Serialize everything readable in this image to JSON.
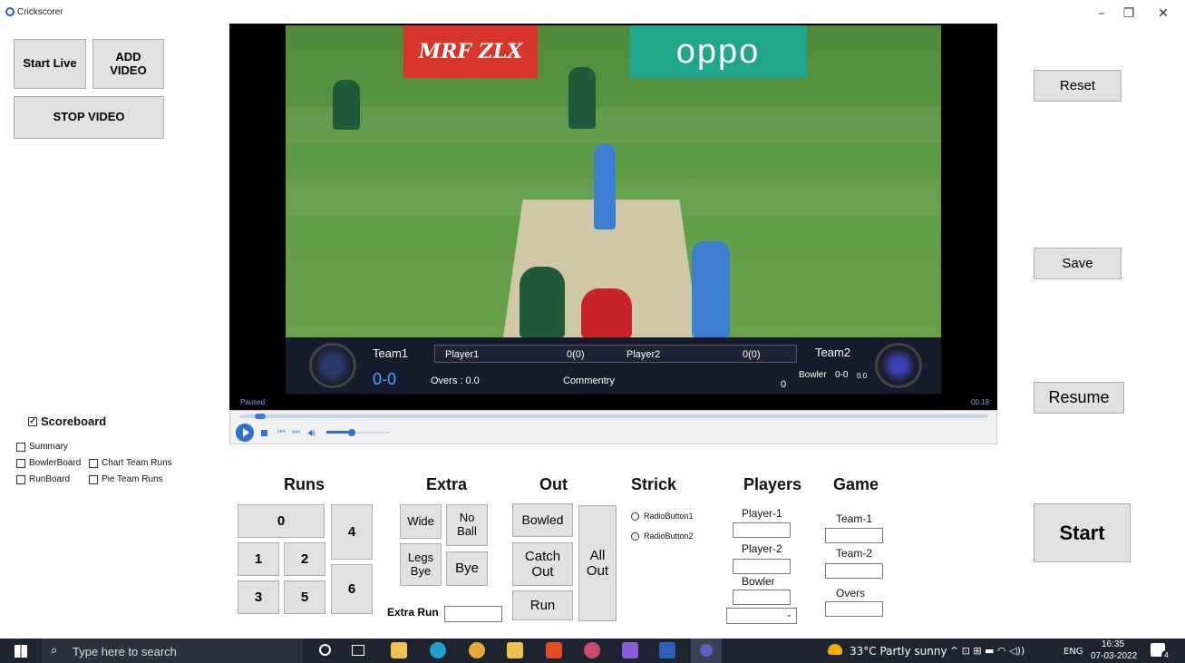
{
  "window": {
    "title": "Crickscorer",
    "minimize": "–",
    "maximize": "❐",
    "close": "✕"
  },
  "left_buttons": {
    "start_live": "Start Live",
    "add_video": "ADD VIDEO",
    "stop_video": "STOP VIDEO"
  },
  "checkboxes": {
    "scoreboard": {
      "label": "Scoreboard",
      "checked": true
    },
    "summary": {
      "label": "Summary",
      "checked": false
    },
    "bowlerboard": {
      "label": "BowlerBoard",
      "checked": false
    },
    "chart_team_runs": {
      "label": "Chart Team Runs",
      "checked": false
    },
    "runboard": {
      "label": "RunBoard",
      "checked": false
    },
    "pie_team_runs": {
      "label": "Pie Team Runs",
      "checked": false
    }
  },
  "video": {
    "ad_left": "MRF ZLX",
    "ad_right": "oppo",
    "team1": "Team1",
    "team1_score": "0-0",
    "player1": "Player1",
    "player1_score": "0(0)",
    "player2": "Player2",
    "player2_score": "0(0)",
    "team2": "Team2",
    "overs": "Overs : 0.0",
    "commentary": "Commentry",
    "zero": "0",
    "bowler": "Bowler",
    "bowler_figures": "0-0",
    "bowler_overs": "0.0",
    "status": "Paused",
    "time": "00:18",
    "seek_progress": 0.02,
    "volume_level": 0.4
  },
  "right_buttons": {
    "reset": "Reset",
    "save": "Save",
    "resume": "Resume",
    "start": "Start"
  },
  "runs": {
    "header": "Runs",
    "zero": "0",
    "one": "1",
    "two": "2",
    "three": "3",
    "four": "4",
    "five": "5",
    "six": "6"
  },
  "extra": {
    "header": "Extra",
    "wide": "Wide",
    "no_ball": "No Ball",
    "legs_bye": "Legs Bye",
    "bye": "Bye",
    "extra_run_label": "Extra Run"
  },
  "out": {
    "header": "Out",
    "bowled": "Bowled",
    "catch_out": "Catch Out",
    "run": "Run",
    "all_out": "All Out"
  },
  "strick": {
    "header": "Strick",
    "radio1": "RadioButton1",
    "radio2": "RadioButton2"
  },
  "players": {
    "header": "Players",
    "player1": "Player-1",
    "player2": "Player-2",
    "bowler": "Bowler"
  },
  "game": {
    "header": "Game",
    "team1": "Team-1",
    "team2": "Team-2",
    "overs": "Overs"
  },
  "taskbar": {
    "search_placeholder": "Type here to search",
    "weather": "33°C  Partly sunny",
    "lang": "ENG",
    "time": "16:35",
    "date": "07-03-2022",
    "notifications": "4"
  }
}
